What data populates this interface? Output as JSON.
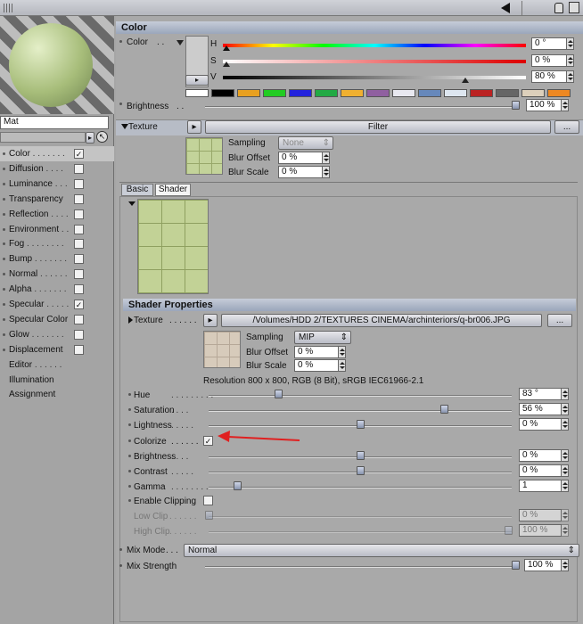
{
  "sidebar": {
    "material_name": "Mat",
    "channels": [
      {
        "label": "Color",
        "checked": true
      },
      {
        "label": "Diffusion",
        "checked": false
      },
      {
        "label": "Luminance",
        "checked": false
      },
      {
        "label": "Transparency",
        "checked": false
      },
      {
        "label": "Reflection",
        "checked": false
      },
      {
        "label": "Environment",
        "checked": false
      },
      {
        "label": "Fog",
        "checked": false
      },
      {
        "label": "Bump",
        "checked": false
      },
      {
        "label": "Normal",
        "checked": false
      },
      {
        "label": "Alpha",
        "checked": false
      },
      {
        "label": "Specular",
        "checked": true
      },
      {
        "label": "Specular Color",
        "checked": false
      },
      {
        "label": "Glow",
        "checked": false
      },
      {
        "label": "Displacement",
        "checked": false
      },
      {
        "label": "Editor",
        "checked": null
      },
      {
        "label": "Illumination",
        "checked": null
      },
      {
        "label": "Assignment",
        "checked": null
      }
    ]
  },
  "color_section": {
    "title": "Color",
    "color_label": "Color",
    "h_label": "H",
    "h_value": "0 °",
    "s_label": "S",
    "s_value": "0 %",
    "v_label": "V",
    "v_value": "80 %",
    "brightness_label": "Brightness",
    "brightness_value": "100 %",
    "preset_swatches": [
      "#ffffff",
      "#000000",
      "#e8a020",
      "#22cc22",
      "#2222dd",
      "#22aa44",
      "#f0b030",
      "#9060a0",
      "#e8e8f0",
      "#6688bb",
      "#dde6f0",
      "#bb2222",
      "#666666",
      "#ddd0bb",
      "#ee8822"
    ]
  },
  "texture_section": {
    "texture_label": "Texture",
    "filter_label": "Filter",
    "more_label": "...",
    "sampling_label": "Sampling",
    "sampling_value": "None",
    "blur_offset_label": "Blur Offset",
    "blur_offset_value": "0 %",
    "blur_scale_label": "Blur Scale",
    "blur_scale_value": "0 %"
  },
  "tabs": {
    "basic": "Basic",
    "shader": "Shader"
  },
  "shader": {
    "title": "Shader Properties",
    "texture_label": "Texture",
    "texture_path": "/Volumes/HDD 2/TEXTURES CINEMA/archinteriors/q-br006.JPG",
    "more_label": "...",
    "sampling_label": "Sampling",
    "sampling_value": "MIP",
    "blur_offset_label": "Blur Offset",
    "blur_offset_value": "0 %",
    "blur_scale_label": "Blur Scale",
    "blur_scale_value": "0 %",
    "resolution": "Resolution 800 x 800, RGB (8 Bit), sRGB IEC61966-2.1",
    "hue_label": "Hue",
    "hue_value": "83 °",
    "saturation_label": "Saturation",
    "saturation_value": "56 %",
    "lightness_label": "Lightness",
    "lightness_value": "0 %",
    "colorize_label": "Colorize",
    "colorize_checked": true,
    "brightness_label": "Brightness",
    "brightness_value": "0 %",
    "contrast_label": "Contrast",
    "contrast_value": "0 %",
    "gamma_label": "Gamma",
    "gamma_value": "1",
    "enable_clipping_label": "Enable Clipping",
    "low_clip_label": "Low Clip",
    "low_clip_value": "0 %",
    "high_clip_label": "High Clip",
    "high_clip_value": "100 %"
  },
  "mix": {
    "mode_label": "Mix Mode",
    "mode_value": "Normal",
    "strength_label": "Mix Strength",
    "strength_value": "100 %"
  },
  "colors": {
    "accent_arrow": "#e02020",
    "header_blue": "#9aa6bb"
  }
}
